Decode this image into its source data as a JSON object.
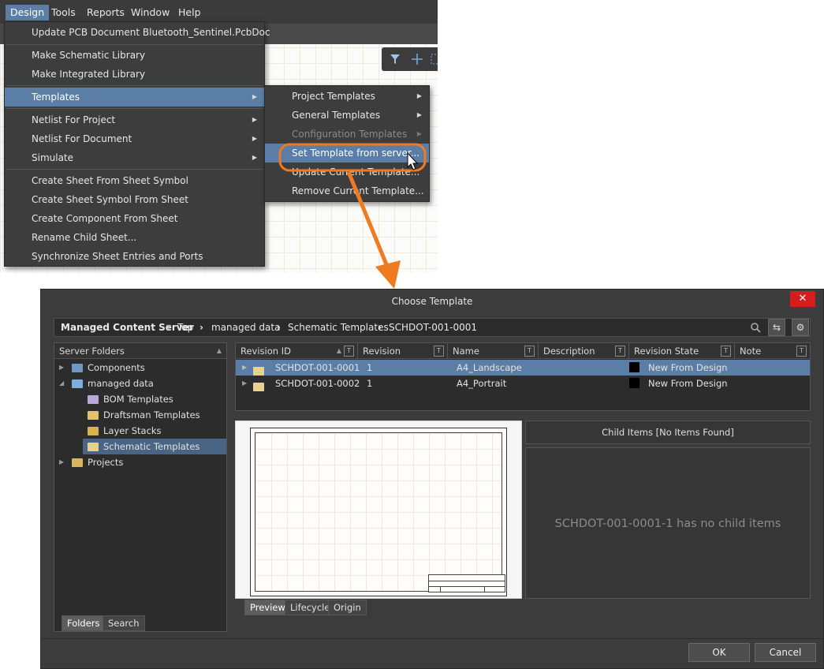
{
  "menubar": {
    "items": [
      "Design",
      "Tools",
      "Reports",
      "Window",
      "Help"
    ]
  },
  "design_menu": {
    "items": [
      {
        "label": "Update PCB Document Bluetooth_Sentinel.PcbDoc"
      },
      {
        "label": "Make Schematic Library"
      },
      {
        "label": "Make Integrated Library"
      },
      {
        "label": "Templates"
      },
      {
        "label": "Netlist For Project"
      },
      {
        "label": "Netlist For Document"
      },
      {
        "label": "Simulate"
      },
      {
        "label": "Create Sheet From Sheet Symbol"
      },
      {
        "label": "Create Sheet Symbol From Sheet"
      },
      {
        "label": "Create Component From Sheet"
      },
      {
        "label": "Rename Child Sheet..."
      },
      {
        "label": "Synchronize Sheet Entries and Ports"
      }
    ]
  },
  "templates_submenu": {
    "items": [
      {
        "label": "Project Templates"
      },
      {
        "label": "General Templates"
      },
      {
        "label": "Configuration Templates"
      },
      {
        "label": "Set Template from server..."
      },
      {
        "label": "Update Current Template..."
      },
      {
        "label": "Remove Current Template..."
      }
    ]
  },
  "dialog": {
    "title": "Choose Template",
    "close_glyph": "✕",
    "server": "Managed Content Server",
    "breadcrumb": [
      "Top",
      "managed data",
      "Schematic Templates",
      "SCHDOT-001-0001"
    ],
    "folders_panel": {
      "header": "Server Folders",
      "items": [
        {
          "label": "Components"
        },
        {
          "label": "managed data"
        },
        {
          "label": "BOM Templates"
        },
        {
          "label": "Draftsman Templates"
        },
        {
          "label": "Layer Stacks"
        },
        {
          "label": "Schematic Templates"
        },
        {
          "label": "Projects"
        }
      ],
      "tabs": [
        "Folders",
        "Search"
      ]
    },
    "table": {
      "columns": [
        "Revision ID",
        "Revision",
        "Name",
        "Description",
        "Revision State",
        "Note"
      ],
      "rows": [
        {
          "id": "SCHDOT-001-0001",
          "revision": "1",
          "name": "A4_Landscape",
          "description": "",
          "state": "New From Design",
          "note": ""
        },
        {
          "id": "SCHDOT-001-0002",
          "revision": "1",
          "name": "A4_Portrait",
          "description": "",
          "state": "New From Design",
          "note": ""
        }
      ]
    },
    "preview_tabs": [
      "Preview",
      "Lifecycle",
      "Origin"
    ],
    "child_items_header": "Child Items [No Items Found]",
    "child_items_message": "SCHDOT-001-0001-1 has no child items",
    "ok_label": "OK",
    "cancel_label": "Cancel"
  },
  "colors": {
    "highlight": "#5a7ea5",
    "callout": "#f07a1f",
    "close": "#d41e1e"
  }
}
